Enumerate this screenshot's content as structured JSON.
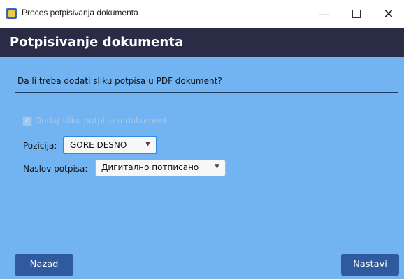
{
  "window": {
    "title": "Proces potpisivanja dokumenta",
    "controls": {
      "minimize": "—",
      "close": "✕"
    }
  },
  "header": {
    "title": "Potpisivanje dokumenta"
  },
  "main": {
    "question": "Da li treba dodati sliku potpisa u PDF dokument?",
    "add_signature_checkbox": {
      "label": "Dodaj sliku potpisa u dokument",
      "checked": true,
      "enabled": false
    },
    "position": {
      "label": "Pozicija:",
      "selected": "GORE DESNO"
    },
    "signature_title": {
      "label": "Naslov potpisa:",
      "selected": "Дигитално потписано"
    }
  },
  "footer": {
    "back_label": "Nazad",
    "next_label": "Nastavi"
  },
  "icons": {
    "checkmark": "✓",
    "dropdown": "▼"
  },
  "colors": {
    "header_bg": "#2a2b44",
    "content_bg": "#72b3f2",
    "button_bg": "#2f5aa0",
    "focus_border": "#2f8ae5"
  }
}
